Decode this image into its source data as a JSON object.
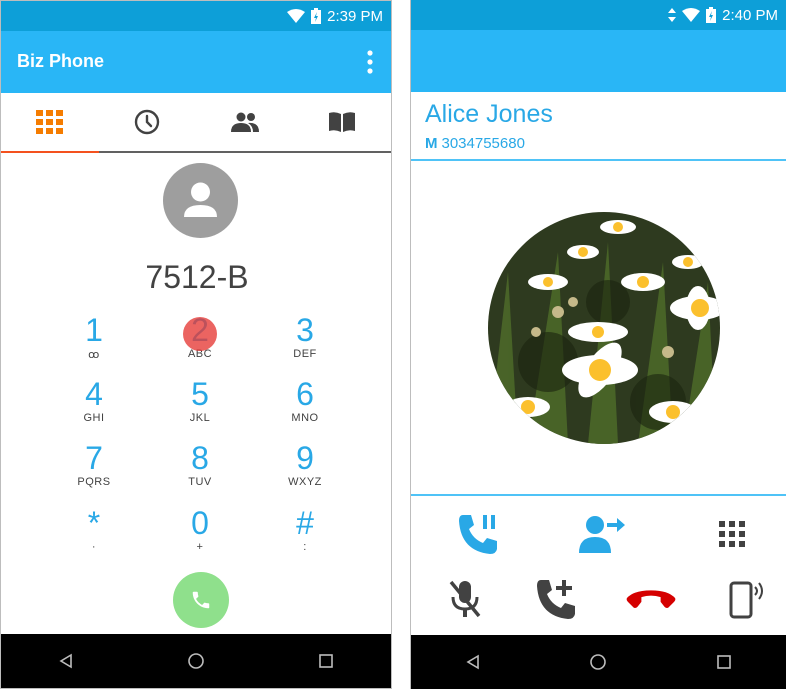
{
  "left": {
    "status": {
      "time": "2:39 PM"
    },
    "appbar": {
      "title": "Biz Phone"
    },
    "tabs": [
      {
        "icon": "dialpad-icon",
        "active": true
      },
      {
        "icon": "recent-calls-icon",
        "active": false
      },
      {
        "icon": "contacts-icon",
        "active": false
      },
      {
        "icon": "directory-book-icon",
        "active": false
      }
    ],
    "dial_number": "7512-B",
    "keys": [
      {
        "digit": "1",
        "letters": "ꝏ"
      },
      {
        "digit": "2",
        "letters": "ABC"
      },
      {
        "digit": "3",
        "letters": "DEF"
      },
      {
        "digit": "4",
        "letters": "GHI"
      },
      {
        "digit": "5",
        "letters": "JKL"
      },
      {
        "digit": "6",
        "letters": "MNO"
      },
      {
        "digit": "7",
        "letters": "PQRS"
      },
      {
        "digit": "8",
        "letters": "TUV"
      },
      {
        "digit": "9",
        "letters": "WXYZ"
      },
      {
        "digit": "*",
        "letters": "·"
      },
      {
        "digit": "0",
        "letters": "+"
      },
      {
        "digit": "#",
        "letters": ":"
      }
    ]
  },
  "right": {
    "status": {
      "time": "2:40 PM"
    },
    "contact": {
      "name": "Alice Jones",
      "number_type": "M",
      "number": "3034755680"
    },
    "controls_row1": [
      "hold-icon",
      "transfer-icon",
      "keypad-icon"
    ],
    "controls_row2": [
      "mute-icon",
      "add-call-icon",
      "end-call-icon",
      "speaker-device-icon"
    ]
  },
  "colors": {
    "statusbar": "#0d9fd8",
    "appbar": "#29b6f6",
    "accent_blue": "#29a8e6",
    "tab_active": "#f4511e",
    "call_green": "#8fe08c",
    "end_call_red": "#d50000"
  }
}
